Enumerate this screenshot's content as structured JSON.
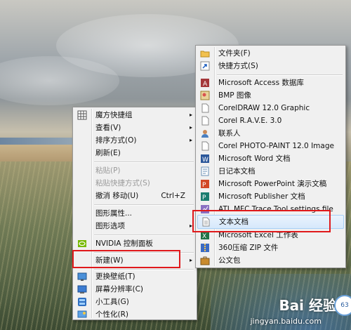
{
  "context_menu": {
    "items": [
      {
        "label": "魔方快捷组",
        "arrow": "▸",
        "icon": "magic-cube-grid-icon"
      },
      {
        "label": "查看(V)",
        "arrow": "▸"
      },
      {
        "label": "排序方式(O)",
        "arrow": "▸"
      },
      {
        "label": "刷新(E)"
      },
      {
        "label": "粘贴(P)",
        "disabled": true
      },
      {
        "label": "粘贴快捷方式(S)",
        "disabled": true
      },
      {
        "label": "撤消 移动(U)",
        "shortcut": "Ctrl+Z"
      },
      {
        "label": "图形属性...",
        "icon": "graphics-icon"
      },
      {
        "label": "图形选项",
        "arrow": "▸"
      },
      {
        "label": "NVIDIA 控制面板",
        "icon": "nvidia-icon"
      },
      {
        "label": "新建(W)",
        "arrow": "▸"
      },
      {
        "label": "更换壁纸(T)",
        "icon": "wallpaper-icon"
      },
      {
        "label": "屏幕分辨率(C)",
        "icon": "screen-resolution-icon"
      },
      {
        "label": "小工具(G)",
        "icon": "gadgets-icon"
      },
      {
        "label": "个性化(R)",
        "icon": "personalize-icon"
      }
    ]
  },
  "new_submenu": {
    "items": [
      {
        "label": "文件夹(F)",
        "icon": "folder-icon"
      },
      {
        "label": "快捷方式(S)",
        "icon": "shortcut-icon"
      },
      {
        "label": "Microsoft Access 数据库",
        "icon": "access-icon"
      },
      {
        "label": "BMP 图像",
        "icon": "bmp-icon"
      },
      {
        "label": "CorelDRAW 12.0 Graphic",
        "icon": "coreldraw-icon"
      },
      {
        "label": "Corel R.A.V.E. 3.0",
        "icon": "corel-rave-icon"
      },
      {
        "label": "联系人",
        "icon": "contact-icon"
      },
      {
        "label": "Corel PHOTO-PAINT 12.0 Image",
        "icon": "photo-paint-icon"
      },
      {
        "label": "Microsoft Word 文档",
        "icon": "word-icon"
      },
      {
        "label": "日记本文档",
        "icon": "journal-icon"
      },
      {
        "label": "Microsoft PowerPoint 演示文稿",
        "icon": "powerpoint-icon"
      },
      {
        "label": "Microsoft Publisher 文档",
        "icon": "publisher-icon"
      },
      {
        "label": "ATL MFC Trace Tool settings file",
        "icon": "atl-trace-icon"
      },
      {
        "label": "文本文档",
        "icon": "text-document-icon"
      },
      {
        "label": "Microsoft Excel 工作表",
        "icon": "excel-icon"
      },
      {
        "label": "360压缩 ZIP 文件",
        "icon": "zip-icon"
      },
      {
        "label": "公文包",
        "icon": "briefcase-icon"
      }
    ]
  },
  "watermark": {
    "brand": "Bai 经验",
    "url": "jingyan.baidu.com",
    "badge": "63"
  },
  "colors": {
    "highlight_border": "#e0191b",
    "menu_bg": "#f0f0f0"
  }
}
